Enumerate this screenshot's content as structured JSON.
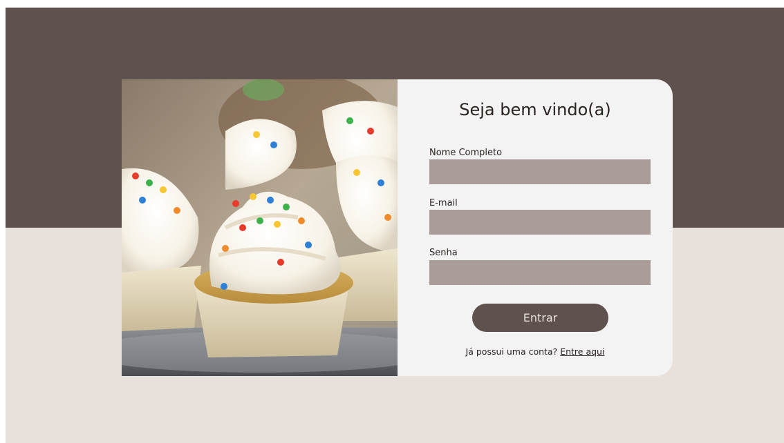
{
  "colors": {
    "band_top": "#5f514e",
    "band_bottom": "#e8e0db",
    "panel": "#f3f3f3",
    "input_bg": "#aa9d99",
    "button_bg": "#5f514e"
  },
  "form": {
    "title": "Seja bem vindo(a)",
    "fields": [
      {
        "label": "Nome Completo",
        "value": ""
      },
      {
        "label": "E-mail",
        "value": ""
      },
      {
        "label": "Senha",
        "value": ""
      }
    ],
    "submit_label": "Entrar",
    "footer_text": "Já possui uma conta?",
    "footer_link": "Entre aqui"
  },
  "photo": {
    "subject": "cupcakes-image"
  }
}
